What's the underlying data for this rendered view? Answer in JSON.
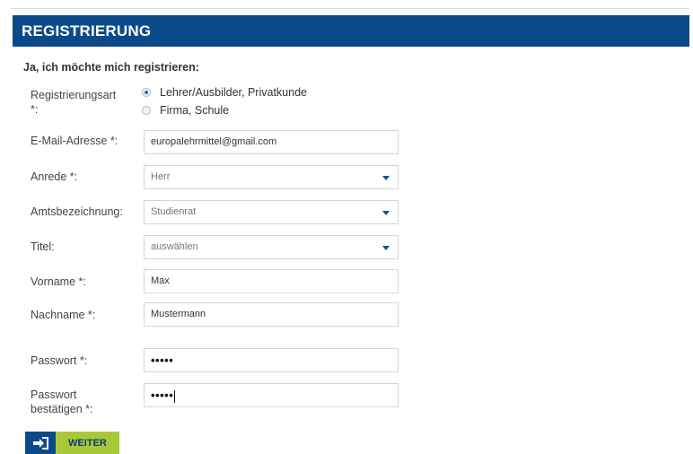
{
  "header": {
    "title": "REGISTRIERUNG"
  },
  "intro": "Ja, ich möchte mich registrieren:",
  "registration_type": {
    "label_line1": "Registrierungsart",
    "label_line2": "*:",
    "options": [
      {
        "label": "Lehrer/Ausbilder, Privatkunde",
        "checked": true
      },
      {
        "label": "Firma, Schule",
        "checked": false
      }
    ]
  },
  "email": {
    "label": "E-Mail-Adresse *:",
    "value": "europalehrmittel@gmail.com"
  },
  "salutation": {
    "label": "Anrede *:",
    "value": "Herr"
  },
  "official_title": {
    "label": "Amtsbezeichnung:",
    "value": "Studienrat"
  },
  "title": {
    "label": "Titel:",
    "value": "auswählen"
  },
  "first_name": {
    "label": "Vorname *:",
    "value": "Max"
  },
  "last_name": {
    "label": "Nachname *:",
    "value": "Mustermann"
  },
  "password": {
    "label": "Passwort *:",
    "value": "•••••"
  },
  "password_confirm": {
    "label_line1": "Passwort",
    "label_line2": "bestätigen *:",
    "value": "•••••"
  },
  "continue_button": {
    "label": "WEITER"
  },
  "colors": {
    "brand_blue": "#0b4a8a",
    "button_green": "#a8c83a"
  }
}
